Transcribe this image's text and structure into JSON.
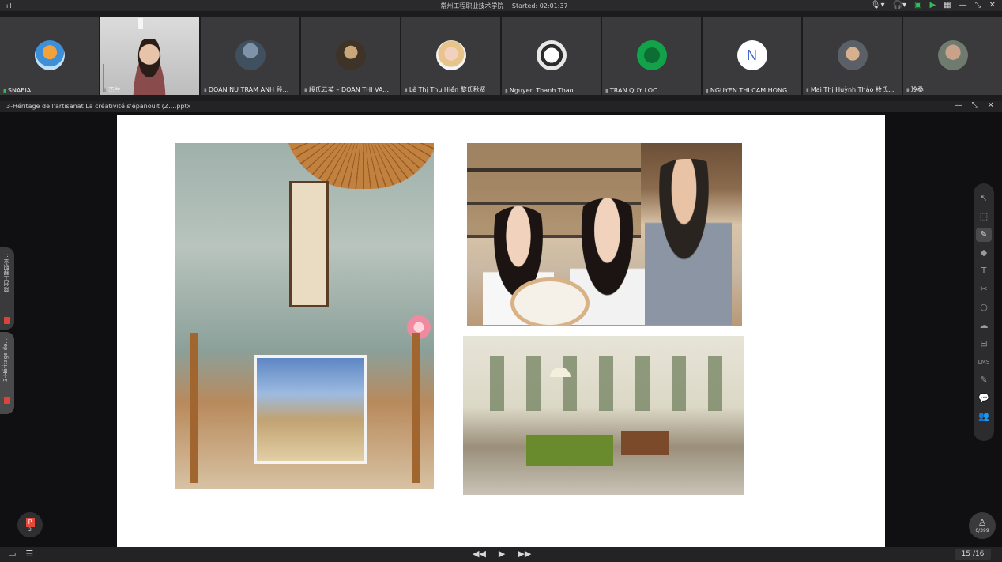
{
  "topbar": {
    "signal": "ıll",
    "org": "常州工程职业技术学院",
    "started": "Started: 02:01:37",
    "controls": [
      "🎙▾",
      "🎧▾",
      "▣",
      "▶",
      "▦",
      "—",
      "⤡",
      "✕"
    ]
  },
  "participants": [
    {
      "name": "SNAEIA",
      "avatar": "balloon"
    },
    {
      "name": "杰兰",
      "avatar": "video"
    },
    {
      "name": "DOAN NU TRAM ANH 段...",
      "avatar": "gray"
    },
    {
      "name": "段氏云英 – DOAN THI VA...",
      "avatar": "dark"
    },
    {
      "name": "Lê Thị Thu Hiền 黎氏秋贤",
      "avatar": "blonde"
    },
    {
      "name": "Nguyen Thanh Thao",
      "avatar": "panda"
    },
    {
      "name": "TRAN QUY LOC",
      "avatar": "green"
    },
    {
      "name": "NGUYEN THI CAM HONG",
      "avatar": "letter",
      "letter": "N"
    },
    {
      "name": "Mai Thị Huỳnh Thảo 枚氏...",
      "avatar": "man"
    },
    {
      "name": "玲桑",
      "avatar": "bald"
    }
  ],
  "document": {
    "title": "3-Héritage de l'artisanat La créativité s'épanouit (Z....pptx",
    "window_controls": [
      "—",
      "⤡",
      "✕"
    ]
  },
  "side_tabs": [
    {
      "label": "常州工程职业..."
    },
    {
      "label": "3-Héritage de..."
    }
  ],
  "tools": [
    "↖",
    "⬚",
    "✎",
    "◆",
    "T",
    "✂",
    "○",
    "☁",
    "⊟",
    "LMS",
    "✎",
    "💬",
    "👥"
  ],
  "ppt_button": {
    "icon": "P",
    "count": "2"
  },
  "record_button": {
    "icon": "♙",
    "count": "0/399"
  },
  "bottom": {
    "left_icons": [
      "▭",
      "☰"
    ],
    "nav": [
      "◀◀",
      "▶",
      "▶▶"
    ],
    "page": "15 /16"
  }
}
